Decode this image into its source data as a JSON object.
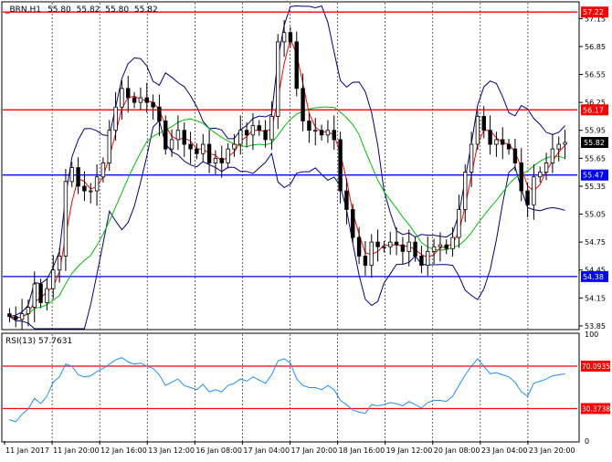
{
  "chart_data": {
    "type": "candlestick",
    "title": "_BRN,H1",
    "ohlc": {
      "open": "55.80",
      "high": "55.82",
      "low": "55.80",
      "close": "55.82"
    },
    "current_price": "55.82",
    "price_ylim": [
      53.82,
      57.32
    ],
    "price_ticks": [
      "57.15",
      "56.85",
      "56.55",
      "56.25",
      "55.95",
      "55.65",
      "55.35",
      "55.05",
      "54.75",
      "54.45",
      "54.15",
      "53.85"
    ],
    "levels": [
      {
        "label": "57.22",
        "value": 57.22,
        "color": "#ff0000"
      },
      {
        "label": "56.17",
        "value": 56.17,
        "color": "#ff0000"
      },
      {
        "label": "55.47",
        "value": 55.47,
        "color": "#0000ff"
      },
      {
        "label": "54.38",
        "value": 54.38,
        "color": "#0000ff"
      }
    ],
    "time_labels": [
      "11 Jan 2017",
      "11 Jan 20:00",
      "12 Jan 16:00",
      "13 Jan 12:00",
      "16 Jan 08:00",
      "17 Jan 04:00",
      "17 Jan 20:00",
      "18 Jan 16:00",
      "19 Jan 12:00",
      "20 Jan 08:00",
      "23 Jan 04:00",
      "23 Jan 20:00"
    ],
    "close_series": [
      53.95,
      53.92,
      53.98,
      54.05,
      54.3,
      54.1,
      54.25,
      54.45,
      54.6,
      55.4,
      55.55,
      55.35,
      55.3,
      55.3,
      55.45,
      55.6,
      55.95,
      56.2,
      56.4,
      56.3,
      56.25,
      56.3,
      56.25,
      56.2,
      56.05,
      55.75,
      55.85,
      55.95,
      55.8,
      55.75,
      55.7,
      55.8,
      55.6,
      55.65,
      55.6,
      55.75,
      55.8,
      55.95,
      55.9,
      56.0,
      55.95,
      55.85,
      56.1,
      56.9,
      57.0,
      56.9,
      56.4,
      56.05,
      55.95,
      55.95,
      55.9,
      55.95,
      55.85,
      55.3,
      55.1,
      54.8,
      54.6,
      54.5,
      54.75,
      54.7,
      54.7,
      54.75,
      54.72,
      54.65,
      54.75,
      54.6,
      54.5,
      54.65,
      54.7,
      54.72,
      54.68,
      54.8,
      55.1,
      55.5,
      55.8,
      56.1,
      55.95,
      55.8,
      55.85,
      55.8,
      55.75,
      55.6,
      55.3,
      55.15,
      55.45,
      55.5,
      55.6,
      55.75,
      55.8,
      55.82
    ],
    "rsi_label": "RSI(13) 57.7631",
    "rsi_ylim": [
      0,
      100
    ],
    "rsi_levels": [
      {
        "label": "70.0935",
        "value": 70.0935,
        "color": "#ff0000"
      },
      {
        "label": "30.3738",
        "value": 30.3738,
        "color": "#ff0000"
      }
    ],
    "rsi_ticks": [
      "100",
      "0"
    ],
    "rsi_values": [
      20,
      18,
      25,
      30,
      40,
      35,
      42,
      55,
      60,
      72,
      70,
      62,
      60,
      61,
      65,
      68,
      72,
      76,
      78,
      74,
      72,
      73,
      70,
      68,
      62,
      52,
      55,
      58,
      52,
      50,
      48,
      53,
      46,
      48,
      46,
      52,
      54,
      58,
      56,
      60,
      57,
      54,
      62,
      75,
      77,
      73,
      58,
      52,
      50,
      50,
      48,
      52,
      48,
      38,
      34,
      29,
      27,
      26,
      34,
      33,
      34,
      36,
      35,
      33,
      37,
      34,
      31,
      36,
      38,
      38,
      37,
      42,
      52,
      62,
      70,
      77,
      70,
      63,
      64,
      62,
      60,
      55,
      46,
      42,
      54,
      56,
      58,
      61,
      62,
      63
    ],
    "colors": {
      "candle": "#000000",
      "bollinger": "#000080",
      "ma_fast": "#ff0000",
      "ma_slow": "#00c000",
      "rsi": "#1e90ff"
    }
  }
}
